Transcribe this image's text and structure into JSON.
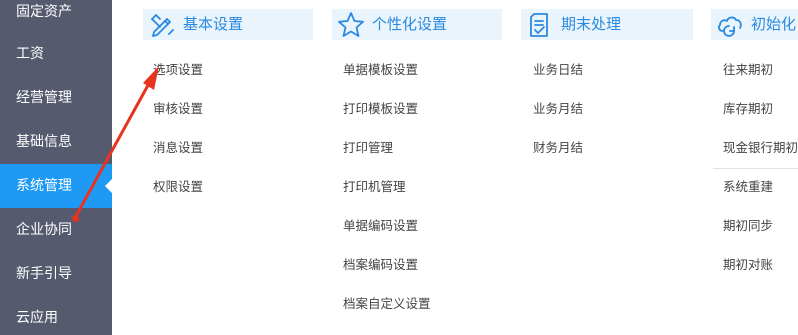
{
  "sidebar": {
    "items": [
      {
        "label": "固定资产"
      },
      {
        "label": "工资"
      },
      {
        "label": "经营管理"
      },
      {
        "label": "基础信息"
      },
      {
        "label": "系统管理"
      },
      {
        "label": "企业协同"
      },
      {
        "label": "新手引导"
      },
      {
        "label": "云应用"
      }
    ],
    "active_label": "系统管理"
  },
  "sections": [
    {
      "title": "基本设置",
      "icon": "pencil-ruler-icon",
      "items": [
        "选项设置",
        "审核设置",
        "消息设置",
        "权限设置"
      ]
    },
    {
      "title": "个性化设置",
      "icon": "star-icon",
      "items": [
        "单据模板设置",
        "打印模板设置",
        "打印管理",
        "打印机管理",
        "单据编码设置",
        "档案编码设置",
        "档案自定义设置"
      ]
    },
    {
      "title": "期末处理",
      "icon": "document-check-icon",
      "items": [
        "业务日结",
        "业务月结",
        "财务月结"
      ]
    },
    {
      "title": "初始化",
      "icon": "cloud-refresh-icon",
      "items": [
        "往来期初",
        "库存期初",
        "现金银行期初",
        "系统重建",
        "期初同步",
        "期初对账"
      ]
    }
  ],
  "colors": {
    "sidebar_bg": "#565a6e",
    "sidebar_active": "#1e9af5",
    "header_bg": "#e9f4fd",
    "accent": "#2a89e0",
    "annotation_arrow": "#e8331f"
  }
}
